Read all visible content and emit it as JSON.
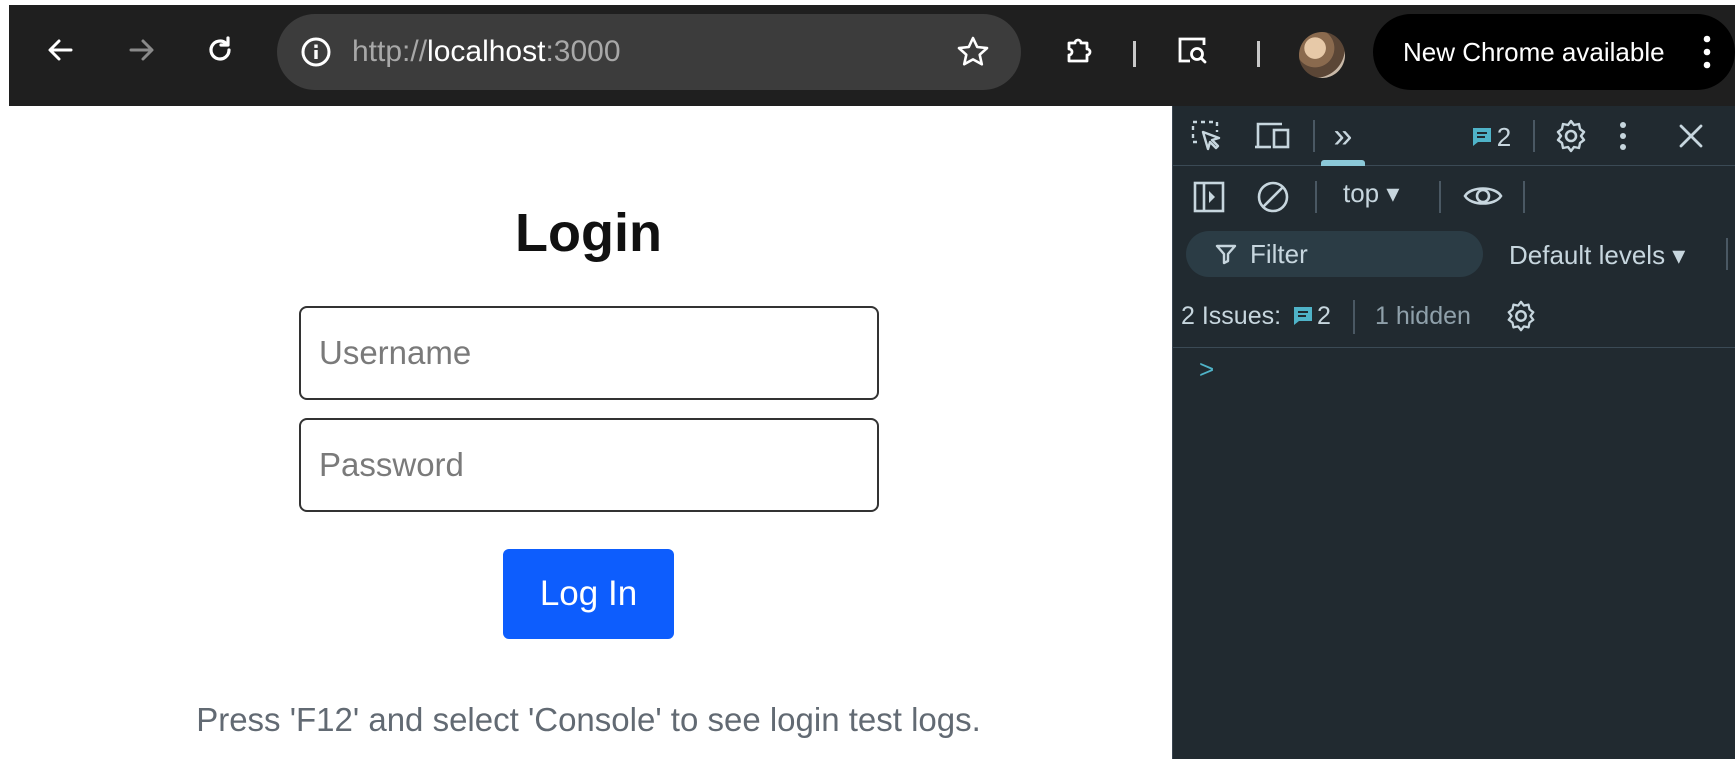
{
  "browser": {
    "url_scheme": "http://",
    "url_host": "localhost",
    "url_port": ":3000",
    "update_label": "New Chrome available"
  },
  "page": {
    "title": "Login",
    "username_placeholder": "Username",
    "password_placeholder": "Password",
    "login_button": "Log In",
    "hint": "Press 'F12' and select 'Console' to see login test logs."
  },
  "devtools": {
    "more_tabs": "»",
    "issues_badge_count": "2",
    "context": "top ▾",
    "filter_label": "Filter",
    "levels_label": "Default levels ▾",
    "issues_label": "2 Issues:",
    "issues_count": "2",
    "hidden_label": "1 hidden",
    "prompt": ">"
  },
  "colors": {
    "primary_button": "#0d5dfd",
    "devtools_bg": "#212a30",
    "toolbar_bg": "#1f1f1f",
    "devtools_accent": "#4fb3c8"
  }
}
